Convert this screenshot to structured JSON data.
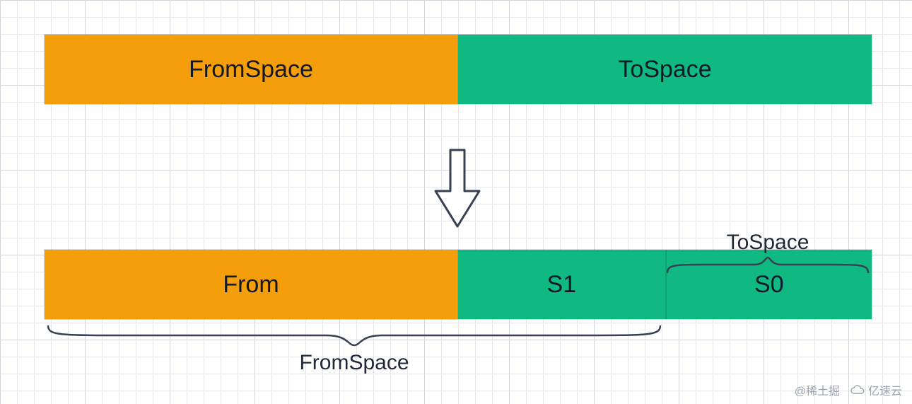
{
  "row1": {
    "from": "FromSpace",
    "to": "ToSpace"
  },
  "row2": {
    "from": "From",
    "s1": "S1",
    "s0": "S0"
  },
  "braces": {
    "top": "ToSpace",
    "bottom": "FromSpace"
  },
  "watermark": {
    "left": "@稀土掘",
    "right": "亿速云"
  },
  "colors": {
    "orange": "#f59e0b",
    "green": "#10b981"
  }
}
